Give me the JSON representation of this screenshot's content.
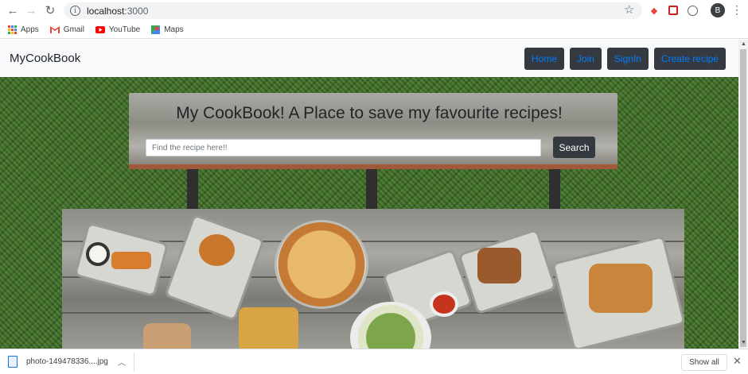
{
  "browser": {
    "url_host": "localhost",
    "url_port": ":3000",
    "profile_initial": "B",
    "bookmarks": [
      {
        "label": "Apps",
        "icon": "apps-grid-icon"
      },
      {
        "label": "Gmail",
        "icon": "gmail-icon"
      },
      {
        "label": "YouTube",
        "icon": "youtube-icon"
      },
      {
        "label": "Maps",
        "icon": "maps-icon"
      }
    ]
  },
  "navbar": {
    "brand": "MyCookBook",
    "links": [
      "Home",
      "Join",
      "SignIn",
      "Create recipe"
    ]
  },
  "hero": {
    "title": "My CookBook! A Place to save my favourite recipes!",
    "search_placeholder": "Find the recipe here!!",
    "search_button": "Search"
  },
  "downloads": {
    "file_name": "photo-149478336....jpg",
    "show_all": "Show all"
  },
  "colors": {
    "nav_bg": "#f8f9fa",
    "button_dark": "#343a40",
    "link_blue": "#007bff"
  }
}
